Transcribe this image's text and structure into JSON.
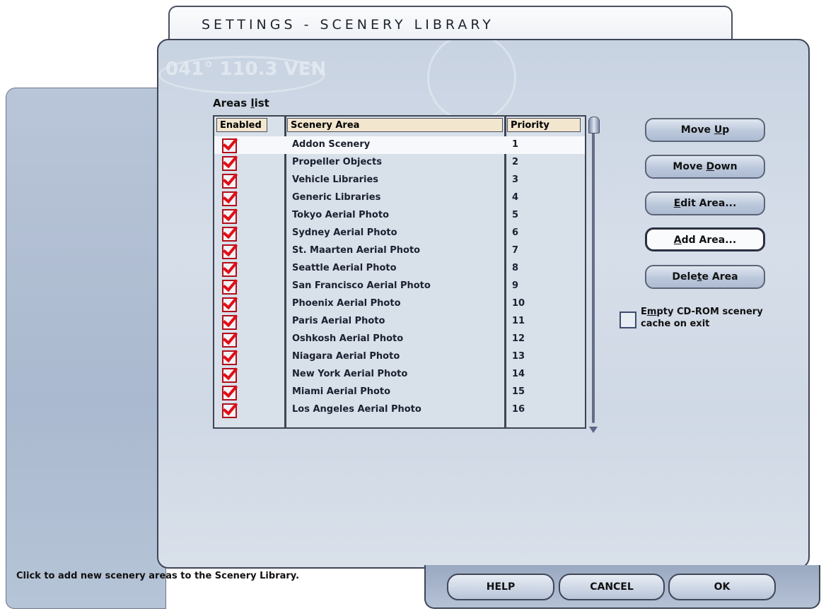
{
  "window": {
    "title": "SETTINGS - SCENERY LIBRARY"
  },
  "list": {
    "label_prefix": "Areas ",
    "label_mnemonic": "l",
    "label_suffix": "ist",
    "columns": [
      "Enabled",
      "Scenery Area",
      "Priority"
    ],
    "rows": [
      {
        "name": "Addon Scenery",
        "priority": "1"
      },
      {
        "name": "Propeller Objects",
        "priority": "2"
      },
      {
        "name": "Vehicle Libraries",
        "priority": "3"
      },
      {
        "name": "Generic Libraries",
        "priority": "4"
      },
      {
        "name": "Tokyo Aerial Photo",
        "priority": "5"
      },
      {
        "name": "Sydney Aerial Photo",
        "priority": "6"
      },
      {
        "name": "St. Maarten Aerial Photo",
        "priority": "7"
      },
      {
        "name": "Seattle Aerial Photo",
        "priority": "8"
      },
      {
        "name": "San Francisco Aerial Photo",
        "priority": "9"
      },
      {
        "name": "Phoenix Aerial Photo",
        "priority": "10"
      },
      {
        "name": "Paris Aerial Photo",
        "priority": "11"
      },
      {
        "name": "Oshkosh Aerial Photo",
        "priority": "12"
      },
      {
        "name": "Niagara Aerial Photo",
        "priority": "13"
      },
      {
        "name": "New York Aerial Photo",
        "priority": "14"
      },
      {
        "name": "Miami Aerial Photo",
        "priority": "15"
      },
      {
        "name": "Los Angeles Aerial Photo",
        "priority": "16"
      }
    ]
  },
  "buttons": {
    "move_up": {
      "pre": "Move ",
      "u": "U",
      "post": "p"
    },
    "move_down": {
      "pre": "Move ",
      "u": "D",
      "post": "own"
    },
    "edit_area": {
      "pre": "",
      "u": "E",
      "post": "dit Area..."
    },
    "add_area": {
      "pre": "",
      "u": "A",
      "post": "dd Area..."
    },
    "delete_area": {
      "pre": "Dele",
      "u": "t",
      "post": "e Area"
    }
  },
  "cd_cache": {
    "pre": "E",
    "u": "m",
    "post": "pty CD-ROM scenery",
    "line2": "cache on exit"
  },
  "status": {
    "text": "Click to add new scenery areas to the Scenery Library."
  },
  "footer": {
    "help": "HELP",
    "cancel": "CANCEL",
    "ok": "OK"
  },
  "decor": {
    "freq": "041° 110.3 VEN"
  }
}
